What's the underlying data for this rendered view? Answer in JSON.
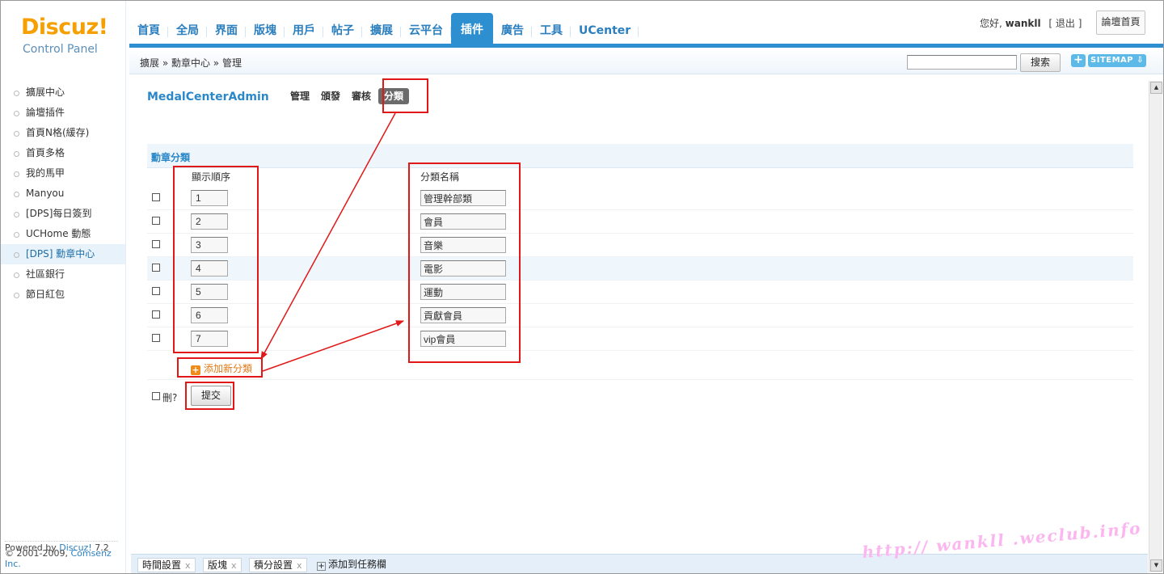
{
  "header": {
    "logo": "Discuz!",
    "logo_sub": "Control Panel",
    "nav": [
      {
        "label": "首頁"
      },
      {
        "label": "全局"
      },
      {
        "label": "界面"
      },
      {
        "label": "版塊"
      },
      {
        "label": "用戶"
      },
      {
        "label": "帖子"
      },
      {
        "label": "擴展"
      },
      {
        "label": "云平台"
      },
      {
        "label": "插件",
        "active": true
      },
      {
        "label": "廣告"
      },
      {
        "label": "工具"
      },
      {
        "label": "UCenter"
      }
    ],
    "greeting": "您好,",
    "username": "wankll",
    "logout": "[ 退出 ]",
    "home_button": "論壇首頁"
  },
  "crumbbar": {
    "breadcrumb": "擴展 » 勳章中心 » 管理",
    "search_value": "",
    "search_button": "搜索",
    "plus_button": "+",
    "sitemap_button": "SITEMAP ⇩"
  },
  "sidebar": {
    "items": [
      {
        "label": "擴展中心"
      },
      {
        "label": "論壇插件"
      },
      {
        "label": "首頁N格(緩存)"
      },
      {
        "label": "首頁多格"
      },
      {
        "label": "我的馬甲"
      },
      {
        "label": "Manyou"
      },
      {
        "label": "[DPS]每日簽到"
      },
      {
        "label": "UCHome 動態"
      },
      {
        "label": "[DPS] 勳章中心",
        "active": true
      },
      {
        "label": "社區銀行"
      },
      {
        "label": "節日紅包"
      }
    ],
    "powered_prefix": "Powered by ",
    "powered_link": "Discuz!",
    "powered_version": " 7.2",
    "copyright_prefix": "© 2001-2009, ",
    "copyright_link": "Comsenz Inc."
  },
  "main": {
    "title": "MedalCenterAdmin",
    "subnav": [
      {
        "label": "管理"
      },
      {
        "label": "頒發"
      },
      {
        "label": "審核"
      },
      {
        "label": "分類",
        "active": true
      }
    ],
    "section_title": "勳章分類",
    "col_order": "顯示順序",
    "col_name": "分類名稱",
    "rows": [
      {
        "order": "1",
        "name": "管理幹部類"
      },
      {
        "order": "2",
        "name": "會員"
      },
      {
        "order": "3",
        "name": "音樂"
      },
      {
        "order": "4",
        "name": "電影"
      },
      {
        "order": "5",
        "name": "運動"
      },
      {
        "order": "6",
        "name": "貢獻會員"
      },
      {
        "order": "7",
        "name": "vip會員"
      }
    ],
    "add_label": "添加新分類",
    "delete_label": "刪?",
    "submit_label": "提交"
  },
  "taskbar": {
    "tasks": [
      {
        "label": "時間設置"
      },
      {
        "label": "版塊"
      },
      {
        "label": "積分設置"
      }
    ],
    "close_glyph": "x",
    "add_label": "添加到任務欄"
  },
  "watermark": "http:// wankll .weclub.info",
  "colors": {
    "accent": "#2e8fd0",
    "logo": "#f59f00",
    "annotation": "#e01818",
    "add_link": "#e27a16"
  },
  "icons": {
    "add": "plus-square-icon",
    "sitemap": "sitemap-icon",
    "scroll_up": "scroll-up-arrow-icon",
    "scroll_down": "scroll-down-arrow-icon"
  }
}
